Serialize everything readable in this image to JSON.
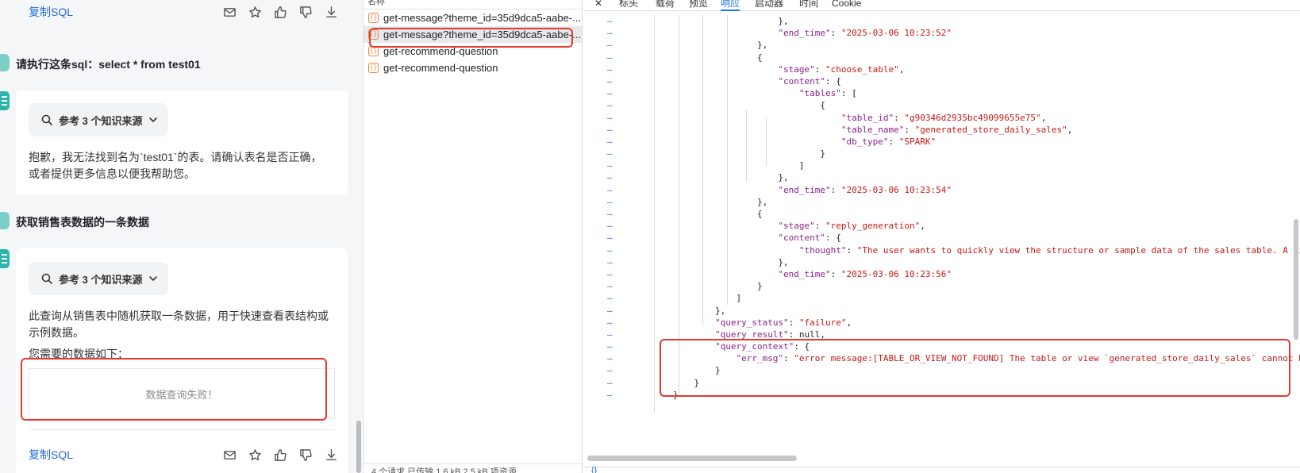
{
  "chat": {
    "copy_sql_label": "复制SQL",
    "messages": [
      {
        "question": "请执行这条sql：select * from test01",
        "kb_label": "参考 3 个知识来源",
        "answer": "抱歉，我无法找到名为`test01`的表。请确认表名是否正确，或者提供更多信息以便我帮助您。"
      },
      {
        "question": "获取销售表数据的一条数据",
        "kb_label": "参考 3 个知识来源",
        "answer": "此查询从销售表中随机获取一条数据，用于快速查看表结构或示例数据。",
        "data_intro": "您需要的数据如下：",
        "result_status": "数据查询失败！"
      }
    ],
    "action_icons": [
      "mail-icon",
      "star-icon",
      "thumbs-up-icon",
      "thumbs-down-icon",
      "download-icon"
    ]
  },
  "network": {
    "column_header": "名称",
    "requests": [
      {
        "name": "get-message?theme_id=35d9dca5-aabe-...",
        "selected": false
      },
      {
        "name": "get-message?theme_id=35d9dca5-aabe-...",
        "selected": true
      },
      {
        "name": "get-recommend-question",
        "selected": false
      },
      {
        "name": "get-recommend-question",
        "selected": false
      }
    ],
    "status_text": "4 个请求  已传输 1.6 kB  2.5 kB 项资源"
  },
  "response": {
    "tabs": [
      "标头",
      "载荷",
      "预览",
      "响应",
      "启动器",
      "时间",
      "Cookie"
    ],
    "active_tab": "响应",
    "close_label": "✕",
    "footer_label": "{}",
    "code_lines": [
      "                            },",
      "                            \"end_time\": \"2025-03-06 10:23:52\"",
      "                        },",
      "                        {",
      "                            \"stage\": \"choose_table\",",
      "                            \"content\": {",
      "                                \"tables\": [",
      "                                    {",
      "                                        \"table_id\": \"g90346d2935bc49099655e75\",",
      "                                        \"table_name\": \"generated_store_daily_sales\",",
      "                                        \"db_type\": \"SPARK\"",
      "                                    }",
      "                                ]",
      "                            },",
      "                            \"end_time\": \"2025-03-06 10:23:54\"",
      "                        },",
      "                        {",
      "                            \"stage\": \"reply_generation\",",
      "                            \"content\": {",
      "                                \"thought\": \"The user wants to quickly view the structure or sample data of the sales table. A simple q",
      "                            },",
      "                            \"end_time\": \"2025-03-06 10:23:56\"",
      "                        }",
      "                    ]",
      "                },",
      "                \"query_status\": \"failure\",",
      "                \"query_result\": null,",
      "                \"query_context\": {",
      "                    \"err_msg\": \"error message:[TABLE_OR_VIEW_NOT_FOUND] The table or view `generated_store_daily_sales` cannot be fo",
      "                }",
      "            }",
      "        }"
    ]
  }
}
